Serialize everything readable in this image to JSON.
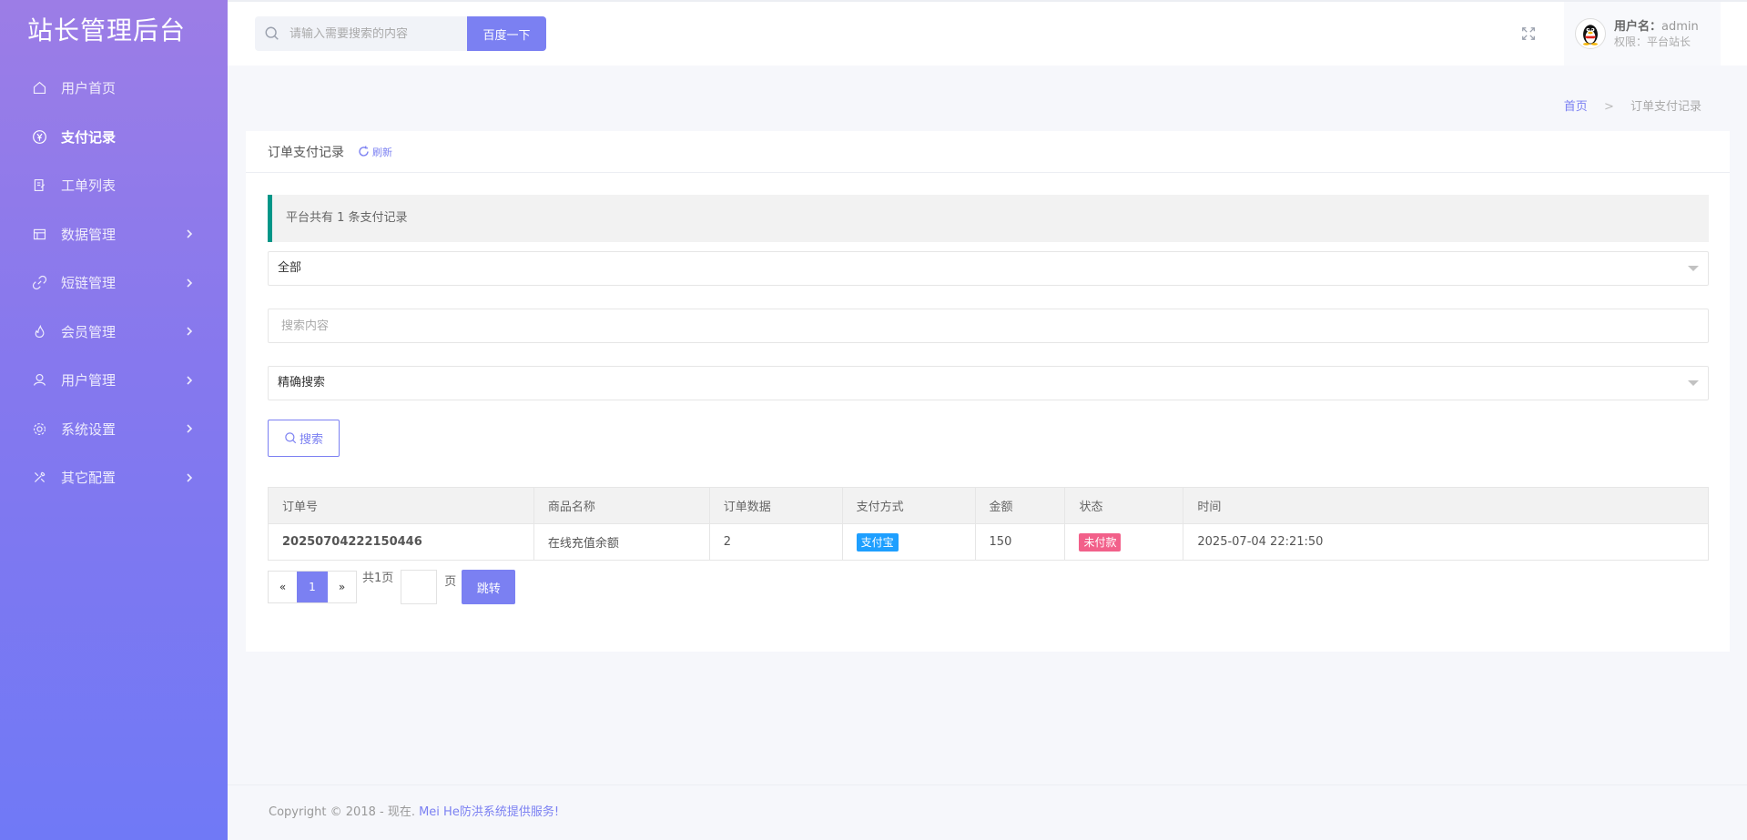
{
  "brand": "站长管理后台",
  "sidebar": {
    "items": [
      {
        "label": "用户首页",
        "icon": "home-icon",
        "has_children": false
      },
      {
        "label": "支付记录",
        "icon": "yen-icon",
        "has_children": false,
        "active": true
      },
      {
        "label": "工单列表",
        "icon": "ticket-icon",
        "has_children": false
      },
      {
        "label": "数据管理",
        "icon": "database-icon",
        "has_children": true
      },
      {
        "label": "短链管理",
        "icon": "link-icon",
        "has_children": true
      },
      {
        "label": "会员管理",
        "icon": "fire-icon",
        "has_children": true
      },
      {
        "label": "用户管理",
        "icon": "user-icon",
        "has_children": true
      },
      {
        "label": "系统设置",
        "icon": "gear-icon",
        "has_children": true
      },
      {
        "label": "其它配置",
        "icon": "tools-icon",
        "has_children": true
      }
    ]
  },
  "header": {
    "search_placeholder": "请输入需要搜索的内容",
    "search_button": "百度一下",
    "user": {
      "name_label": "用户名：",
      "name": "admin",
      "role": "权限：平台站长"
    }
  },
  "breadcrumb": {
    "home": "首页",
    "separator": ">",
    "current": "订单支付记录"
  },
  "card": {
    "title": "订单支付记录",
    "refresh": "刷新",
    "notice": "平台共有 1 条支付记录",
    "status_select": "全部",
    "search_placeholder": "搜索内容",
    "mode_select": "精确搜索",
    "query_button": "搜索"
  },
  "table": {
    "columns": [
      "订单号",
      "商品名称",
      "订单数据",
      "支付方式",
      "金额",
      "状态",
      "时间"
    ],
    "rows": [
      {
        "order_no": "20250704222150446",
        "product": "在线充值余额",
        "order_data": "2",
        "pay_method": "支付宝",
        "amount": "150",
        "status": "未付款",
        "time": "2025-07-04 22:21:50"
      }
    ]
  },
  "pager": {
    "prev": "«",
    "current": "1",
    "next": "»",
    "total": "共1页",
    "unit": "页",
    "go": "跳转"
  },
  "footer": {
    "text": "Copyright © 2018 - 现在. ",
    "link": "Mei He防洪系统提供服务!"
  },
  "colors": {
    "accent": "#7b80f2",
    "notice_border": "#009688",
    "badge_blue": "#1e9fff",
    "badge_red": "#f2608a"
  }
}
